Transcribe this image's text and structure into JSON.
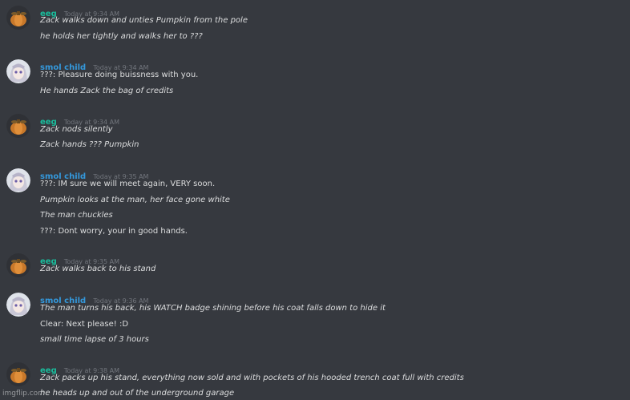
{
  "users": {
    "eeg": {
      "name": "eeg",
      "color": "#1abc9c",
      "avatar": "pumpkin-avatar-icon"
    },
    "smol": {
      "name": "smol child",
      "color": "#3498db",
      "avatar": "anime-girl-avatar-icon"
    }
  },
  "messages": [
    {
      "author": "eeg",
      "time": "Today at 9:34 AM",
      "lines": [
        {
          "text": "Zack walks down and unties Pumpkin from the pole",
          "italic": true
        },
        {
          "text": "he holds her tightly and walks her to ???",
          "italic": true
        }
      ]
    },
    {
      "author": "smol child",
      "time": "Today at 9:34 AM",
      "lines": [
        {
          "text": "???: Pleasure doing buissness with you.",
          "italic": false
        },
        {
          "text": "He hands Zack the bag of credits",
          "italic": true
        }
      ]
    },
    {
      "author": "eeg",
      "time": "Today at 9:34 AM",
      "lines": [
        {
          "text": "Zack nods silently",
          "italic": true
        },
        {
          "text": "Zack hands ??? Pumpkin",
          "italic": true
        }
      ]
    },
    {
      "author": "smol child",
      "time": "Today at 9:35 AM",
      "lines": [
        {
          "text": "???: IM sure we will meet again, VERY soon.",
          "italic": false
        },
        {
          "text": "Pumpkin looks at the man, her face gone white",
          "italic": true
        },
        {
          "text": "The man chuckles",
          "italic": true
        },
        {
          "text": "???: Dont worry, your in good hands.",
          "italic": false
        }
      ]
    },
    {
      "author": "eeg",
      "time": "Today at 9:35 AM",
      "lines": [
        {
          "text": "Zack walks back to his stand",
          "italic": true
        }
      ]
    },
    {
      "author": "smol child",
      "time": "Today at 9:36 AM",
      "lines": [
        {
          "text": "The man turns his back, his WATCH badge shining before his coat falls down to hide it",
          "italic": true
        },
        {
          "text": "Clear: Next please! :D",
          "italic": false
        },
        {
          "text": "small time lapse of 3 hours",
          "italic": true
        }
      ]
    },
    {
      "author": "eeg",
      "time": "Today at 9:38 AM",
      "lines": [
        {
          "text": "Zack packs up his stand, everything now sold and with pockets of his hooded trench coat full with credits",
          "italic": true
        },
        {
          "text": "he heads up and out of the underground garage",
          "italic": true
        }
      ]
    }
  ],
  "watermark": "imgflip.com"
}
